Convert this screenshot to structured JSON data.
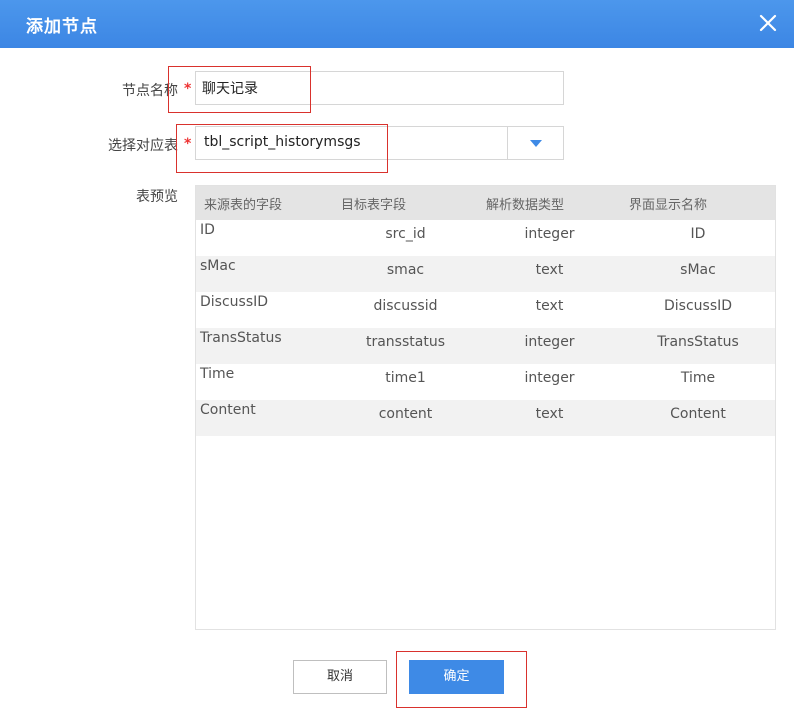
{
  "dialog": {
    "title": "添加节点"
  },
  "form": {
    "node_name": {
      "label": "节点名称",
      "required_mark": "*",
      "value": "聊天记录"
    },
    "table_select": {
      "label": "选择对应表",
      "required_mark": "*",
      "selected_value": "tbl_script_historymsgs"
    },
    "preview": {
      "label": "表预览",
      "columns": [
        "来源表的字段",
        "目标表字段",
        "解析数据类型",
        "界面显示名称"
      ],
      "rows": [
        [
          "ID",
          "src_id",
          "integer",
          "ID"
        ],
        [
          "sMac",
          "smac",
          "text",
          "sMac"
        ],
        [
          "DiscussID",
          "discussid",
          "text",
          "DiscussID"
        ],
        [
          "TransStatus",
          "transstatus",
          "integer",
          "TransStatus"
        ],
        [
          "Time",
          "time1",
          "integer",
          "Time"
        ],
        [
          "Content",
          "content",
          "text",
          "Content"
        ]
      ]
    }
  },
  "buttons": {
    "cancel": "取消",
    "ok": "确定"
  },
  "colors": {
    "header": "#3c86e4",
    "primary": "#3e8ae6",
    "highlight": "#d9322d",
    "required": "#ee3333"
  }
}
